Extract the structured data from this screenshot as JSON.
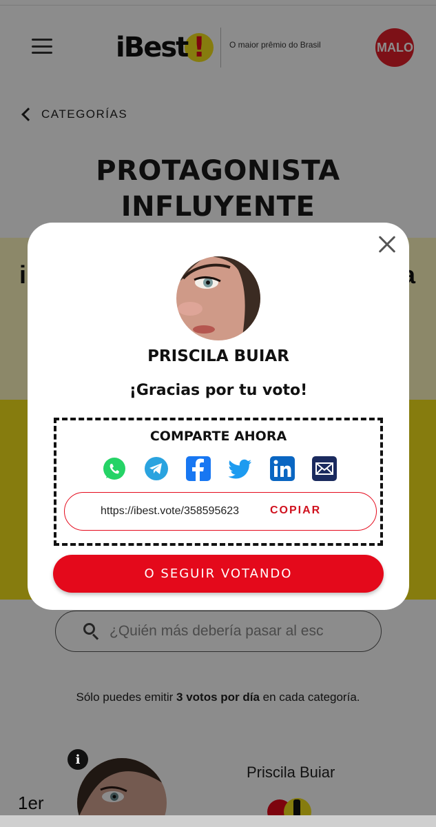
{
  "header": {
    "logo_text": "iBest",
    "logo_mark": "!",
    "tagline": "O maior prêmio do Brasil",
    "avatar_text": "MALO",
    "menu_icon": "hamburger-menu-icon"
  },
  "breadcrumb": {
    "label": "CATEGORÍAS"
  },
  "category": {
    "title_line1": "PROTAGONISTA",
    "title_line2": "INFLUYENTE"
  },
  "band": {
    "left_char": "i",
    "right_char": "a"
  },
  "search": {
    "placeholder": "¿Quién más debería pasar al esc"
  },
  "votes_note": {
    "before": "Sólo puedes emitir ",
    "bold": "3 votos por día",
    "after": " en cada categoría."
  },
  "candidate": {
    "rank": "1er",
    "name": "Priscila Buiar",
    "info_icon": "i"
  },
  "modal": {
    "name": "PRISCILA BUIAR",
    "thanks": "¡Gracias por tu voto!",
    "share_title": "COMPARTE AHORA",
    "share_icons": [
      "whatsapp-icon",
      "telegram-icon",
      "facebook-icon",
      "twitter-icon",
      "linkedin-icon",
      "email-icon"
    ],
    "link_url": "https://ibest.vote/358595623",
    "copy_label": "COPIAR",
    "continue_label": "O SEGUIR VOTANDO"
  },
  "colors": {
    "brand_red": "#e4091b",
    "brand_yellow": "#f4e21a",
    "whatsapp": "#25d366",
    "telegram": "#2aa3df",
    "facebook": "#1877f2",
    "twitter": "#1d9bf0",
    "linkedin": "#0a66c2",
    "email": "#1a2a5e"
  }
}
